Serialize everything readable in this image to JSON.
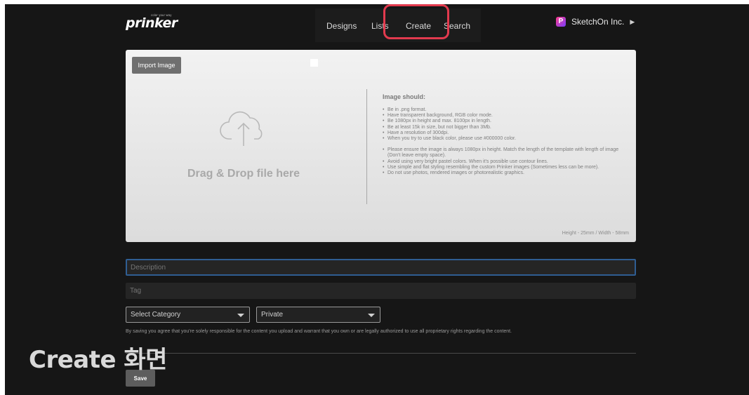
{
  "brand": {
    "logo_text": "prinker",
    "tagline": "color your way"
  },
  "nav": {
    "items": [
      "Designs",
      "Lists",
      "Create",
      "Search"
    ],
    "highlight_color": "#e23a4e"
  },
  "account": {
    "name": "SketchOn Inc.",
    "logo_letter": "P",
    "arrow": "▶"
  },
  "upload": {
    "import_label": "Import Image",
    "drop_text": "Drag & Drop file here",
    "cloud_icon": "cloud-upload-icon",
    "rules_title": "Image should:",
    "rules_group1": [
      "Be in .png format.",
      "Have transparent background, RGB color mode.",
      "Be 1080px in height and max. 8100px in length.",
      "Be at least 15k in size, but not bigger than 3Mb.",
      "Have a resolution of 300dpi.",
      "When you try to use black color, please use #000000 color."
    ],
    "rules_group2": [
      "Please ensure the image is always 1080px in height. Match the length of the template with length of image (Don't leave empty space).",
      "Avoid using very bright pastel colors. When it's possible use contour lines.",
      "Use simple and flat styling resembling the custom Prinker images (Sometimes less can be more).",
      "Do not use photos, rendered images or photorealistic graphics."
    ],
    "size_note": "Height - 25mm / Width - 58mm"
  },
  "form": {
    "description_placeholder": "Description",
    "tag_placeholder": "Tag",
    "category_value": "Select Category",
    "privacy_value": "Private",
    "disclaimer": "By saving you agree that you're solely responsible for the content you upload and warrant that you own or are legally authorized to use all proprietary rights regarding the content.",
    "save_label": "Save"
  },
  "caption": "Create 화면",
  "colors": {
    "accent_blue": "#2f5e93",
    "background": "#161616"
  }
}
